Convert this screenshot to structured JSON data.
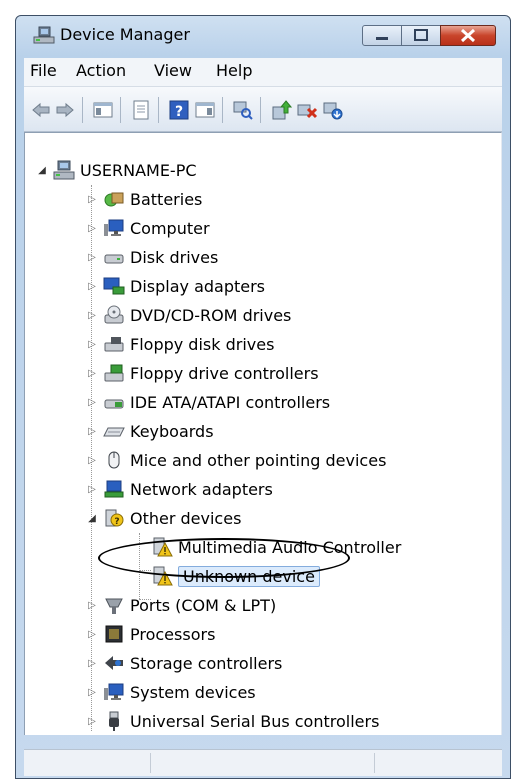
{
  "window": {
    "title": "Device Manager"
  },
  "menu": [
    "File",
    "Action",
    "View",
    "Help"
  ],
  "toolbar_icons": [
    "back-icon",
    "forward-icon",
    "show-hide-console-tree-icon",
    "properties-icon",
    "help-icon",
    "action-pane-icon",
    "scan-hardware-icon",
    "update-driver-icon",
    "uninstall-icon",
    "enable-icon"
  ],
  "tree": {
    "root": "USERNAME-PC",
    "categories": [
      "Batteries",
      "Computer",
      "Disk drives",
      "Display adapters",
      "DVD/CD-ROM drives",
      "Floppy disk drives",
      "Floppy drive controllers",
      "IDE ATA/ATAPI controllers",
      "Keyboards",
      "Mice and other pointing devices",
      "Network adapters",
      "Other devices",
      "Ports (COM & LPT)",
      "Processors",
      "Storage controllers",
      "System devices",
      "Universal Serial Bus controllers"
    ],
    "other_devices_children": [
      "Multimedia Audio Controller",
      "Unknown device"
    ],
    "selected": "Unknown device"
  },
  "colors": {
    "warning": "#f0c419",
    "selection": "#dcebfc",
    "accent": "#3b6fb6"
  }
}
